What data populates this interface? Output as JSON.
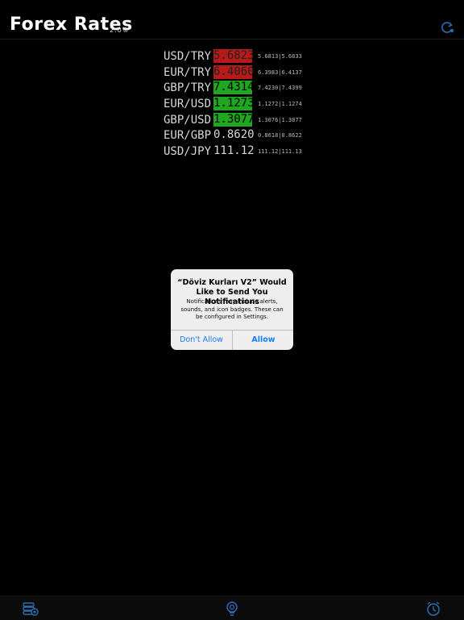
{
  "header": {
    "title": "Forex Rates",
    "version": "2.0®"
  },
  "rates": [
    {
      "pair": "USD/TRY",
      "price": "5.6823",
      "bidask": "5.6813|5.6833",
      "trend": "down"
    },
    {
      "pair": "EUR/TRY",
      "price": "6.4060",
      "bidask": "6.3983|6.4137",
      "trend": "down"
    },
    {
      "pair": "GBP/TRY",
      "price": "7.4314",
      "bidask": "7.4230|7.4399",
      "trend": "up"
    },
    {
      "pair": "EUR/USD",
      "price": "1.1273",
      "bidask": "1.1272|1.1274",
      "trend": "up"
    },
    {
      "pair": "GBP/USD",
      "price": "1.3077",
      "bidask": "1.3076|1.3077",
      "trend": "up"
    },
    {
      "pair": "EUR/GBP",
      "price": "0.8620",
      "bidask": "0.8618|0.8622",
      "trend": "none"
    },
    {
      "pair": "USD/JPY",
      "price": "111.12",
      "bidask": "111.12|111.13",
      "trend": "none"
    }
  ],
  "alert": {
    "title": "“Döviz Kurları V2” Would Like to Send You Notifications",
    "message": "Notifications may include alerts, sounds, and icon badges. These can be configured in Settings.",
    "deny_label": "Don't Allow",
    "allow_label": "Allow"
  },
  "colors": {
    "up": "#1fa81f",
    "down": "#b81a1a",
    "accent": "#1a7ef5",
    "icon": "#2a6fb0"
  },
  "icons": {
    "refresh": "refresh-icon",
    "tab1": "currency-list-icon",
    "tab2": "lightbulb-icon",
    "tab3": "alarm-clock-icon"
  }
}
